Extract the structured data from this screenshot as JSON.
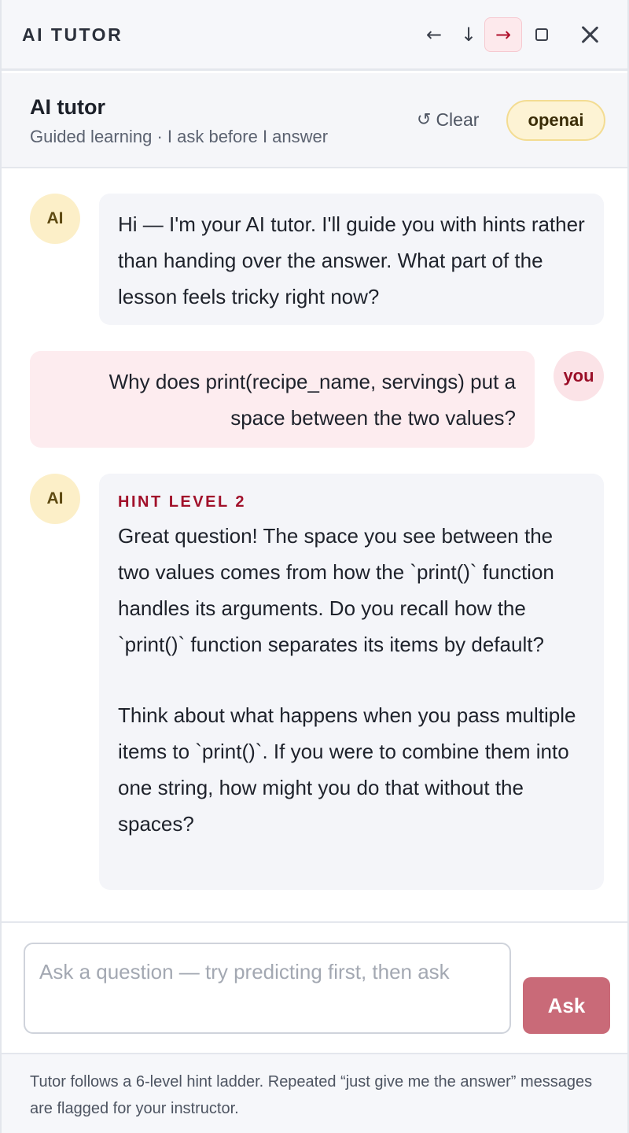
{
  "window": {
    "title": "AI TUTOR",
    "buttons": {
      "dock_left": "←",
      "dock_bottom": "↓",
      "dock_right": "→"
    }
  },
  "header": {
    "title": "AI tutor",
    "subtitle": "Guided learning · I ask before I answer",
    "clear_icon": "↺",
    "clear_label": "Clear",
    "provider": "openai"
  },
  "messages": [
    {
      "role": "assistant",
      "avatar": "AI",
      "text": "Hi — I'm your AI tutor. I'll guide you with hints rather than handing over the answer. What part of the lesson feels tricky right now?"
    },
    {
      "role": "user",
      "avatar": "you",
      "text": "Why does print(recipe_name, servings) put a space between the two values?"
    },
    {
      "role": "assistant",
      "avatar": "AI",
      "hint_label": "HINT LEVEL 2",
      "paragraphs": [
        "Great question! The space you see between the two values comes from how the `print()` function handles its arguments. Do you recall how the `print()` function separates its items by default?",
        "Think about what happens when you pass multiple items to `print()`. If you were to combine them into one string, how might you do that without the spaces?"
      ]
    }
  ],
  "composer": {
    "placeholder": "Ask a question — try predicting first, then ask",
    "value": "",
    "ask_label": "Ask"
  },
  "footer": {
    "text": "Tutor follows a 6-level hint ladder. Repeated “just give me the answer” messages are flagged for your instructor."
  }
}
